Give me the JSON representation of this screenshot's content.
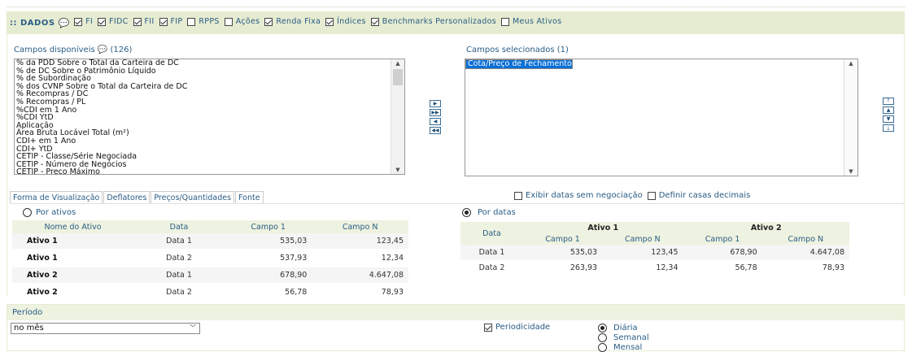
{
  "filters": {
    "title": ":: DADOS",
    "items": [
      {
        "label": "FI",
        "checked": true
      },
      {
        "label": "FIDC",
        "checked": true
      },
      {
        "label": "FII",
        "checked": true
      },
      {
        "label": "FIP",
        "checked": true
      },
      {
        "label": "RPPS",
        "checked": false
      },
      {
        "label": "Ações",
        "checked": false
      },
      {
        "label": "Renda Fixa",
        "checked": true
      },
      {
        "label": "Índices",
        "checked": true
      },
      {
        "label": "Benchmarks Personalizados",
        "checked": true
      },
      {
        "label": "Meus Ativos",
        "checked": false
      }
    ]
  },
  "available": {
    "label": "Campos disponíveis",
    "count": "(126)",
    "items": [
      "% da PDD Sobre o Total da Carteira de DC",
      "% de DC Sobre o Patrimônio Líquido",
      "% de Subordinação",
      "% dos CVNP Sobre o Total da Carteira de DC",
      "% Recompras / DC",
      "% Recompras / PL",
      "%CDI em 1 Ano",
      "%CDI YtD",
      "Aplicação",
      "Área Bruta Locável Total (m²)",
      "CDI+ em 1 Ano",
      "CDI+ YtD",
      "CETIP - Classe/Série Negociada",
      "CETIP - Número de Negócios",
      "CETIP - Preço Máximo"
    ]
  },
  "selected": {
    "label": "Campos selecionados (1)",
    "items": [
      "Cota/Preço de Fechamento"
    ]
  },
  "tabs": [
    "Forma de Visualização",
    "Deflatores",
    "Preços/Quantidades",
    "Fonte"
  ],
  "options": {
    "no_trade": "Exibir datas sem negociação",
    "decimals": "Definir casas decimais"
  },
  "by_assets": {
    "label": "Por ativos",
    "headers": [
      "Nome do Ativo",
      "Data",
      "Campo 1",
      "Campo N"
    ],
    "rows": [
      [
        "Ativo 1",
        "Data 1",
        "535,03",
        "123,45"
      ],
      [
        "Ativo 1",
        "Data 2",
        "537,93",
        "12,34"
      ],
      [
        "Ativo 2",
        "Data 1",
        "678,90",
        "4.647,08"
      ],
      [
        "Ativo 2",
        "Data 2",
        "56,78",
        "78,93"
      ]
    ]
  },
  "by_dates": {
    "label": "Por datas",
    "data_header": "Data",
    "groups": [
      "Ativo 1",
      "Ativo 2"
    ],
    "subheaders": [
      "Campo 1",
      "Campo N",
      "Campo 1",
      "Campo N"
    ],
    "rows": [
      [
        "Data 1",
        "535,03",
        "123,45",
        "678,90",
        "4.647,08"
      ],
      [
        "Data 2",
        "263,93",
        "12,34",
        "56,78",
        "78,93"
      ]
    ]
  },
  "period": {
    "title": "Período",
    "select_value": "no mês",
    "periodicity_label": "Periodicidade",
    "periodicity_options": [
      "Diária",
      "Semanal",
      "Mensal"
    ],
    "selected_periodicity": "Diária"
  },
  "colors": {
    "accent": "#2a5d86",
    "bar": "#e6ecd1",
    "selection": "#0a6fd6"
  }
}
